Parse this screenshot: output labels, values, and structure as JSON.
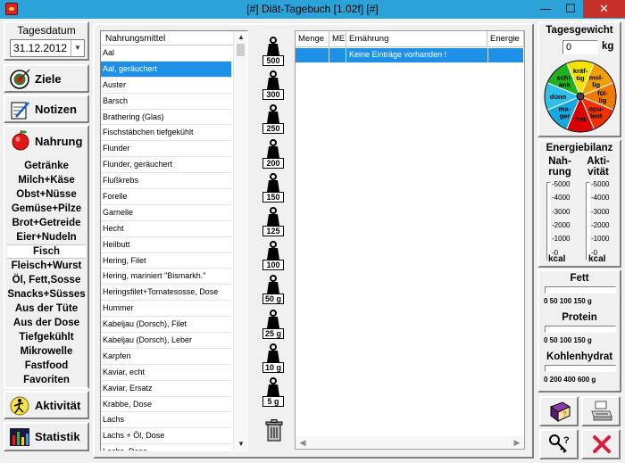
{
  "window": {
    "title": "[#] Diät-Tagebuch [1.02f] [#]",
    "min": "—",
    "max": "☐",
    "close": "✕"
  },
  "date": {
    "label": "Tagesdatum",
    "value": "31.12.2012"
  },
  "nav": {
    "ziele": "Ziele",
    "notizen": "Notizen",
    "nahrung": "Nahrung",
    "aktivitaet": "Aktivität",
    "statistik": "Statistik"
  },
  "categories": [
    "Getränke",
    "Milch+Käse",
    "Obst+Nüsse",
    "Gemüse+Pilze",
    "Brot+Getreide",
    "Eier+Nudeln",
    "Fisch",
    "Fleisch+Wurst",
    "Öl, Fett,Sosse",
    "Snacks+Süsses",
    "Aus der Tüte",
    "Aus der Dose",
    "Tiefgekühlt",
    "Mikrowelle",
    "Fastfood",
    "Favoriten"
  ],
  "selected_category": "Fisch",
  "food_list": {
    "header": "Nahrungsmittel",
    "selected": "Aal, geräuchert",
    "items": [
      "Aal",
      "Aal, geräuchert",
      "Auster",
      "Barsch",
      "Brathering (Glas)",
      "Fischstäbchen tiefgekühlt",
      "Flunder",
      "Flunder, geräuchert",
      "Flußkrebs",
      "Forelle",
      "Garnelle",
      "Hecht",
      "Heilbutt",
      "Hering, Filet",
      "Hering, mariniert \"Bismarkh.\"",
      "Heringsfilet+Tomatesosse, Dose",
      "Hummer",
      "Kabeljau (Dorsch), Filet",
      "Kabeljau (Dorsch), Leber",
      "Karpfen",
      "Kaviar, echt",
      "Kaviar, Ersatz",
      "Krabbe, Dose",
      "Lachs",
      "Lachs + Öl, Dose",
      "Lachs, Dose"
    ]
  },
  "weights": [
    "500",
    "300",
    "250",
    "200",
    "150",
    "125",
    "100",
    "50 g",
    "25 g",
    "10 g",
    "5 g"
  ],
  "entries": {
    "columns": [
      "Menge",
      "ME",
      "Ernährung",
      "Energie"
    ],
    "empty_text": "Keine Einträge vorhanden !"
  },
  "tagesgewicht": {
    "label": "Tagesgewicht",
    "value": "0",
    "unit": "kg",
    "segments": [
      "kräf-tig",
      "mol-lig",
      "fül-lig",
      "opu-lent",
      "fett",
      "ma-ger",
      "dünn",
      "schl-ank"
    ]
  },
  "energiebilanz": {
    "label": "Energiebilanz",
    "nahrung_label": "Nah- rung",
    "aktivitaet_label": "Akti- vität",
    "ticks": [
      "5000",
      "4000",
      "3000",
      "2000",
      "1000",
      "0"
    ],
    "unit": "kcal",
    "nahrung_kcal": 0,
    "aktivitaet_kcal": 0
  },
  "nutrients": [
    {
      "label": "Fett",
      "scale": "0   50  100  150  g",
      "value": 0
    },
    {
      "label": "Protein",
      "scale": "0   50  100  150  g",
      "value": 0
    },
    {
      "label": "Kohlenhydrat",
      "scale": "0  200 400 600  g",
      "value": 0
    }
  ]
}
